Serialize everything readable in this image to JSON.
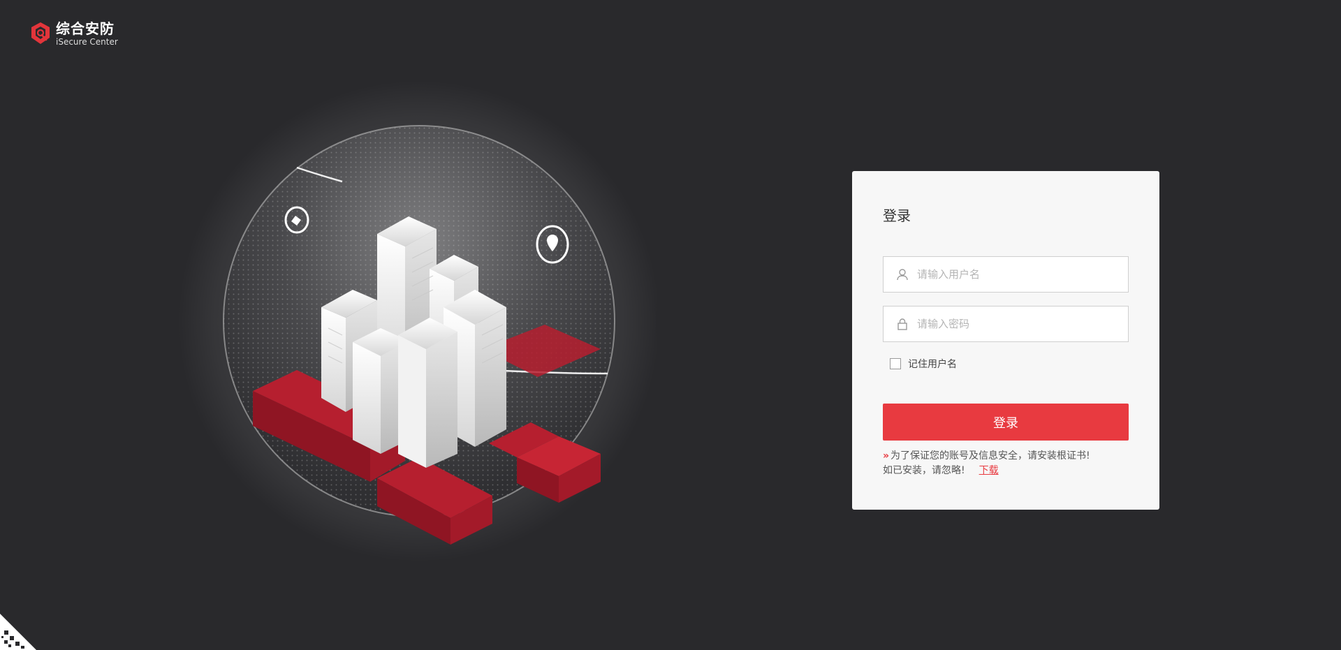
{
  "logo": {
    "cn": "综合安防",
    "en": "iSecure Center",
    "icon": "shield-logo-icon"
  },
  "login": {
    "title": "登录",
    "username_placeholder": "请输入用户名",
    "password_placeholder": "请输入密码",
    "remember_label": "记住用户名",
    "remember_checked": false,
    "submit_label": "登录",
    "notice_line1": "为了保证您的账号及信息安全，请安装根证书!",
    "notice_line2": "如已安装，请忽略!",
    "download_label": "下载"
  },
  "icons": {
    "user": "user-icon",
    "lock": "lock-icon",
    "notice": "double-chevron-icon"
  },
  "colors": {
    "background": "#29292c",
    "card": "#f7f7f7",
    "accent": "#e83a40"
  }
}
